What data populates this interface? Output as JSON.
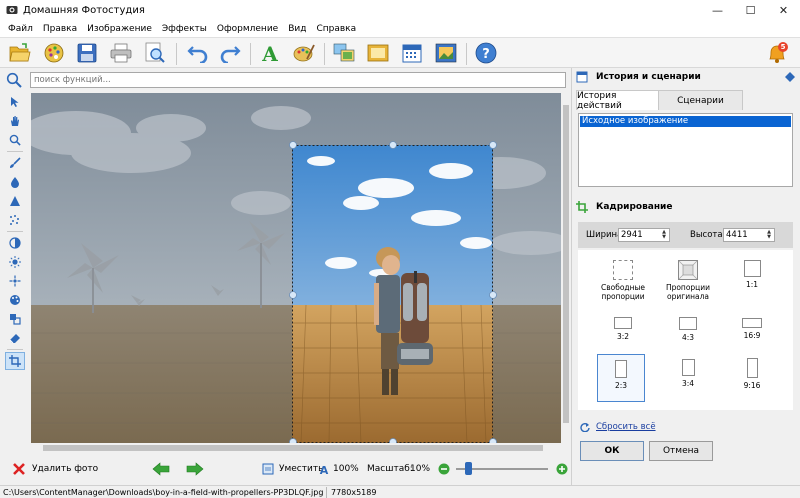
{
  "window": {
    "title": "Домашняя Фотостудия"
  },
  "menu": [
    "Файл",
    "Правка",
    "Изображение",
    "Эффекты",
    "Оформление",
    "Вид",
    "Справка"
  ],
  "toolbar": {
    "icons": [
      "open-folder-icon",
      "palette-disc-icon",
      "save-icon",
      "print-icon",
      "preview-icon",
      "undo-icon",
      "redo-icon",
      "text-icon",
      "paint-palette-icon",
      "collage-icon",
      "frame-icon",
      "calendar-icon",
      "postcard-icon",
      "help-icon"
    ],
    "notification_count": "5"
  },
  "search": {
    "placeholder": "поиск функций..."
  },
  "right_panel": {
    "history_header": "История и сценарии",
    "tabs": [
      "История действий",
      "Сценарии"
    ],
    "history_items": [
      "Исходное изображение"
    ],
    "crop_header": "Кадрирование",
    "width_label": "Ширина",
    "width_value": "2941",
    "height_label": "Высота",
    "height_value": "4411",
    "crop_options": [
      {
        "label": "Свободные пропорции",
        "selected": false
      },
      {
        "label": "Пропорции оригинала",
        "selected": false
      },
      {
        "label": "1:1",
        "selected": false
      },
      {
        "label": "3:2",
        "selected": false
      },
      {
        "label": "4:3",
        "selected": false
      },
      {
        "label": "16:9",
        "selected": false
      },
      {
        "label": "2:3",
        "selected": true
      },
      {
        "label": "3:4",
        "selected": false
      },
      {
        "label": "9:16",
        "selected": false
      }
    ],
    "reset_label": "Сбросить всё",
    "ok_label": "ОК",
    "cancel_label": "Отмена"
  },
  "bottom": {
    "delete_label": "Удалить фото",
    "fit_label": "Уместить",
    "zoom_100_label": "100%",
    "scale_label": "Масштаб:",
    "scale_value": "10%",
    "zoom_level": 0.1
  },
  "status": {
    "path": "C:\\Users\\ContentManager\\Downloads\\boy-in-a-field-with-propellers-PP3DLQF.jpg",
    "dimensions": "7780x5189"
  },
  "colors": {
    "accent": "#0a64d2",
    "green": "#3aa43a",
    "notify": "#e8432c"
  }
}
